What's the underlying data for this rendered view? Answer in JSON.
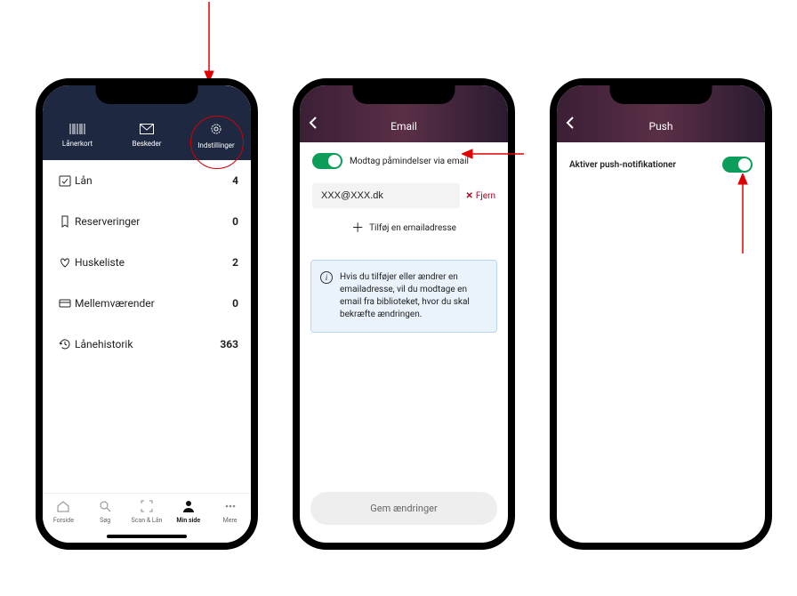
{
  "phone1": {
    "top_tabs": {
      "lanerkort": "Lånerkort",
      "beskeder": "Beskeder",
      "indstillinger": "Indstillinger"
    },
    "menu": {
      "lan": {
        "label": "Lån",
        "count": "4"
      },
      "reserveringer": {
        "label": "Reserveringer",
        "count": "0"
      },
      "huskeliste": {
        "label": "Huskeliste",
        "count": "2"
      },
      "mellemvarender": {
        "label": "Mellemværender",
        "count": "0"
      },
      "lanehistorik": {
        "label": "Lånehistorik",
        "count": "363"
      }
    },
    "bottom_nav": {
      "forside": "Forside",
      "sog": "Søg",
      "scanlan": "Scan & Lån",
      "minside": "Min side",
      "mere": "Mere"
    }
  },
  "phone2": {
    "title": "Email",
    "toggle_label": "Modtag påmindelser via email",
    "email_value": "XXX@XXX.dk",
    "remove_label": "Fjern",
    "add_label": "Tilføj en emailadresse",
    "info_text": "Hvis du tilføjer eller ændrer en emailadresse, vil du modtage en email fra biblioteket, hvor du skal bekræfte ændringen.",
    "save_label": "Gem ændringer"
  },
  "phone3": {
    "title": "Push",
    "toggle_label": "Aktiver push-notifikationer"
  }
}
